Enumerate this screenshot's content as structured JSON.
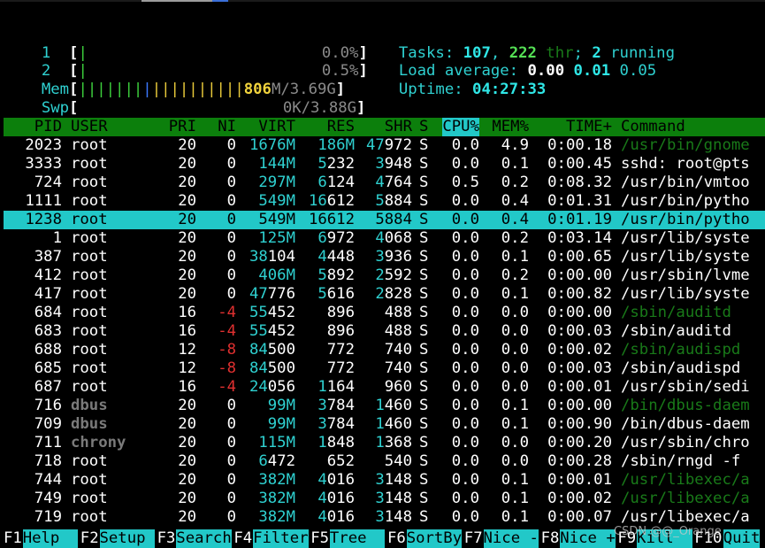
{
  "meters": {
    "cpu1": {
      "label": "1",
      "value": "0.0%",
      "fill": 0.01
    },
    "cpu2": {
      "label": "2",
      "value": "0.5%",
      "fill": 0.01
    },
    "mem": {
      "label": "Mem",
      "value_used": "806",
      "value_rest": "M/3.69G"
    },
    "swp": {
      "label": "Swp",
      "value": "0K/3.88G"
    }
  },
  "summary": {
    "tasks_label": "Tasks: ",
    "tasks": "107",
    "sep1": ", ",
    "threads": "222",
    "thr_label": " thr",
    "sep2": "; ",
    "running": "2",
    "running_label": " running",
    "load_label": "Load average: ",
    "load1": "0.00",
    "load5": "0.01",
    "load15": "0.05",
    "uptime_label": "Uptime: ",
    "uptime": "04:27:33"
  },
  "columns": [
    "PID",
    "USER",
    "PRI",
    "NI",
    "VIRT",
    "RES",
    "SHR",
    "S",
    "CPU%",
    "MEM%",
    "TIME+",
    "Command"
  ],
  "sort_column": "CPU%",
  "processes": [
    {
      "pid": "2023",
      "user": "root",
      "pri": "20",
      "ni": "0",
      "virt": "1676M",
      "res": "186M",
      "shr": "47972",
      "s": "S",
      "cpu": "0.0",
      "mem": "4.9",
      "time": "0:00.18",
      "cmd": "/usr/bin/gnome",
      "thread": true
    },
    {
      "pid": "3333",
      "user": "root",
      "pri": "20",
      "ni": "0",
      "virt": "144M",
      "res": "5232",
      "shr": "3948",
      "s": "S",
      "cpu": "0.0",
      "mem": "0.1",
      "time": "0:00.45",
      "cmd": "sshd: root@pts",
      "thread": false
    },
    {
      "pid": "724",
      "user": "root",
      "pri": "20",
      "ni": "0",
      "virt": "297M",
      "res": "6124",
      "shr": "4764",
      "s": "S",
      "cpu": "0.5",
      "mem": "0.2",
      "time": "0:08.32",
      "cmd": "/usr/bin/vmtoo",
      "thread": false
    },
    {
      "pid": "1111",
      "user": "root",
      "pri": "20",
      "ni": "0",
      "virt": "549M",
      "res": "16612",
      "shr": "5884",
      "s": "S",
      "cpu": "0.0",
      "mem": "0.4",
      "time": "0:01.31",
      "cmd": "/usr/bin/pytho",
      "thread": false
    },
    {
      "pid": "1238",
      "user": "root",
      "pri": "20",
      "ni": "0",
      "virt": "549M",
      "res": "16612",
      "shr": "5884",
      "s": "S",
      "cpu": "0.0",
      "mem": "0.4",
      "time": "0:01.19",
      "cmd": "/usr/bin/pytho",
      "thread": false,
      "selected": true
    },
    {
      "pid": "1",
      "user": "root",
      "pri": "20",
      "ni": "0",
      "virt": "125M",
      "res": "6972",
      "shr": "4068",
      "s": "S",
      "cpu": "0.0",
      "mem": "0.2",
      "time": "0:03.14",
      "cmd": "/usr/lib/syste",
      "thread": false
    },
    {
      "pid": "387",
      "user": "root",
      "pri": "20",
      "ni": "0",
      "virt": "38104",
      "res": "4448",
      "shr": "3936",
      "s": "S",
      "cpu": "0.0",
      "mem": "0.1",
      "time": "0:00.65",
      "cmd": "/usr/lib/syste",
      "thread": false
    },
    {
      "pid": "412",
      "user": "root",
      "pri": "20",
      "ni": "0",
      "virt": "406M",
      "res": "5892",
      "shr": "2592",
      "s": "S",
      "cpu": "0.0",
      "mem": "0.2",
      "time": "0:00.00",
      "cmd": "/usr/sbin/lvme",
      "thread": false
    },
    {
      "pid": "417",
      "user": "root",
      "pri": "20",
      "ni": "0",
      "virt": "47776",
      "res": "5616",
      "shr": "2828",
      "s": "S",
      "cpu": "0.0",
      "mem": "0.1",
      "time": "0:00.82",
      "cmd": "/usr/lib/syste",
      "thread": false
    },
    {
      "pid": "684",
      "user": "root",
      "pri": "16",
      "ni": "-4",
      "virt": "55452",
      "res": "896",
      "shr": "488",
      "s": "S",
      "cpu": "0.0",
      "mem": "0.0",
      "time": "0:00.00",
      "cmd": "/sbin/auditd",
      "thread": true
    },
    {
      "pid": "683",
      "user": "root",
      "pri": "16",
      "ni": "-4",
      "virt": "55452",
      "res": "896",
      "shr": "488",
      "s": "S",
      "cpu": "0.0",
      "mem": "0.0",
      "time": "0:00.03",
      "cmd": "/sbin/auditd",
      "thread": false
    },
    {
      "pid": "688",
      "user": "root",
      "pri": "12",
      "ni": "-8",
      "virt": "84500",
      "res": "772",
      "shr": "740",
      "s": "S",
      "cpu": "0.0",
      "mem": "0.0",
      "time": "0:00.02",
      "cmd": "/sbin/audispd",
      "thread": true
    },
    {
      "pid": "685",
      "user": "root",
      "pri": "12",
      "ni": "-8",
      "virt": "84500",
      "res": "772",
      "shr": "740",
      "s": "S",
      "cpu": "0.0",
      "mem": "0.0",
      "time": "0:00.03",
      "cmd": "/sbin/audispd",
      "thread": false
    },
    {
      "pid": "687",
      "user": "root",
      "pri": "16",
      "ni": "-4",
      "virt": "24056",
      "res": "1164",
      "shr": "960",
      "s": "S",
      "cpu": "0.0",
      "mem": "0.0",
      "time": "0:00.01",
      "cmd": "/usr/sbin/sedi",
      "thread": false
    },
    {
      "pid": "716",
      "user": "dbus",
      "pri": "20",
      "ni": "0",
      "virt": "99M",
      "res": "3784",
      "shr": "1460",
      "s": "S",
      "cpu": "0.0",
      "mem": "0.1",
      "time": "0:00.00",
      "cmd": "/bin/dbus-daem",
      "thread": true
    },
    {
      "pid": "709",
      "user": "dbus",
      "pri": "20",
      "ni": "0",
      "virt": "99M",
      "res": "3784",
      "shr": "1460",
      "s": "S",
      "cpu": "0.0",
      "mem": "0.1",
      "time": "0:00.90",
      "cmd": "/bin/dbus-daem",
      "thread": false
    },
    {
      "pid": "711",
      "user": "chrony",
      "pri": "20",
      "ni": "0",
      "virt": "115M",
      "res": "1848",
      "shr": "1368",
      "s": "S",
      "cpu": "0.0",
      "mem": "0.0",
      "time": "0:00.20",
      "cmd": "/usr/sbin/chro",
      "thread": false
    },
    {
      "pid": "718",
      "user": "root",
      "pri": "20",
      "ni": "0",
      "virt": "6472",
      "res": "652",
      "shr": "540",
      "s": "S",
      "cpu": "0.0",
      "mem": "0.0",
      "time": "0:00.28",
      "cmd": "/sbin/rngd -f",
      "thread": false
    },
    {
      "pid": "744",
      "user": "root",
      "pri": "20",
      "ni": "0",
      "virt": "382M",
      "res": "4016",
      "shr": "3148",
      "s": "S",
      "cpu": "0.0",
      "mem": "0.1",
      "time": "0:00.01",
      "cmd": "/usr/libexec/a",
      "thread": true
    },
    {
      "pid": "749",
      "user": "root",
      "pri": "20",
      "ni": "0",
      "virt": "382M",
      "res": "4016",
      "shr": "3148",
      "s": "S",
      "cpu": "0.0",
      "mem": "0.1",
      "time": "0:00.02",
      "cmd": "/usr/libexec/a",
      "thread": true
    },
    {
      "pid": "719",
      "user": "root",
      "pri": "20",
      "ni": "0",
      "virt": "382M",
      "res": "4016",
      "shr": "3148",
      "s": "S",
      "cpu": "0.0",
      "mem": "0.1",
      "time": "0:00.07",
      "cmd": "/usr/libexec/a",
      "thread": false
    }
  ],
  "function_keys": [
    {
      "key": "F1",
      "label": "Help  "
    },
    {
      "key": "F2",
      "label": "Setup "
    },
    {
      "key": "F3",
      "label": "Search"
    },
    {
      "key": "F4",
      "label": "Filter"
    },
    {
      "key": "F5",
      "label": "Tree  "
    },
    {
      "key": "F6",
      "label": "SortBy"
    },
    {
      "key": "F7",
      "label": "Nice -"
    },
    {
      "key": "F8",
      "label": "Nice +"
    },
    {
      "key": "F9",
      "label": "Kill  "
    },
    {
      "key": "F10",
      "label": "Quit"
    }
  ],
  "watermark": "CSDN @@_Orange",
  "colors": {
    "header_bg": "#0c7f0c",
    "selection_bg": "#22c8c8",
    "label_cyan": "#2fd1d1"
  }
}
